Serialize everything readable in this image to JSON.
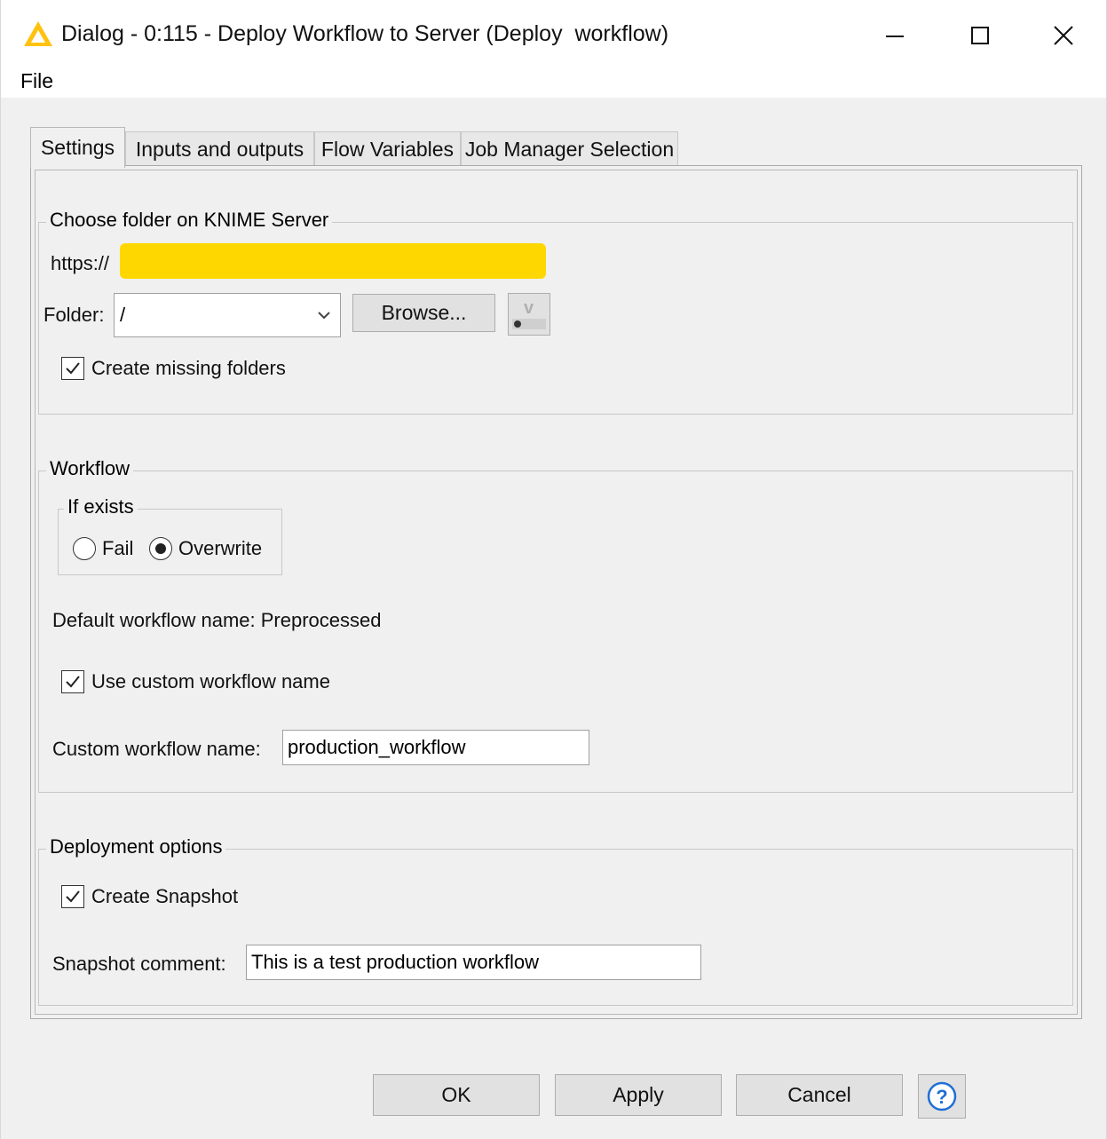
{
  "window": {
    "title": "Dialog - 0:115 - Deploy Workflow to Server (Deploy  workflow)",
    "icon": "knime-warning-triangle-icon",
    "controls": [
      "minimize-icon",
      "maximize-icon",
      "close-icon"
    ]
  },
  "menu": {
    "items": [
      "File"
    ]
  },
  "tabs": [
    {
      "label": "Settings",
      "active": true
    },
    {
      "label": "Inputs and outputs",
      "active": false
    },
    {
      "label": "Flow Variables",
      "active": false
    },
    {
      "label": "Job Manager Selection",
      "active": false
    }
  ],
  "server_group": {
    "title": "Choose folder on KNIME Server",
    "url_prefix": "https://",
    "folder_label": "Folder:",
    "folder_value": "/",
    "browse_label": "Browse...",
    "create_missing_label": "Create missing folders",
    "create_missing_checked": true
  },
  "workflow_group": {
    "title": "Workflow",
    "if_exists_title": "If exists",
    "options": [
      "Fail",
      "Overwrite"
    ],
    "selected": "Overwrite",
    "default_name_text": "Default workflow name: Preprocessed",
    "use_custom_label": "Use custom workflow name",
    "use_custom_checked": true,
    "custom_name_label": "Custom workflow name:",
    "custom_name_value": "production_workflow"
  },
  "deployment_group": {
    "title": "Deployment options",
    "create_snapshot_label": "Create Snapshot",
    "create_snapshot_checked": true,
    "comment_label": "Snapshot comment:",
    "comment_value": "This is a test production workflow"
  },
  "buttons": {
    "ok": "OK",
    "apply": "Apply",
    "cancel": "Cancel",
    "help_icon": "help-question-icon"
  },
  "colors": {
    "accent_yellow": "#ffd700",
    "help_blue": "#1e6fd6",
    "window_bg": "#f0f0f0"
  }
}
